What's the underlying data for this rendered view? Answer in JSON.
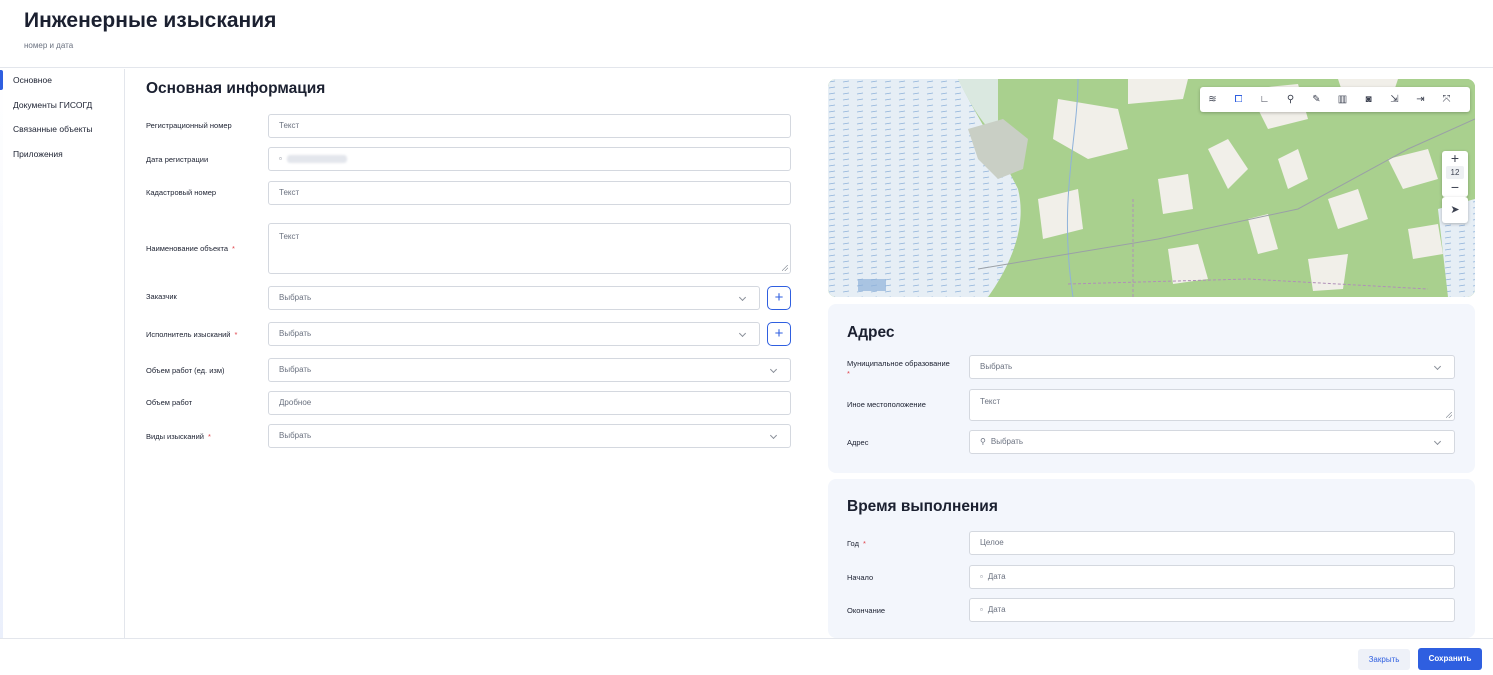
{
  "header": {
    "title": "Инженерные изыскания",
    "subtitle": "номер и дата"
  },
  "sidebar": {
    "items": [
      {
        "label": "Основное",
        "active": true
      },
      {
        "label": "Документы ГИСОГД",
        "active": false
      },
      {
        "label": "Связанные объекты",
        "active": false
      },
      {
        "label": "Приложения",
        "active": false
      }
    ]
  },
  "main_info": {
    "title": "Основная информация",
    "fields": {
      "reg_number": {
        "label": "Регистрационный номер",
        "placeholder": "Текст"
      },
      "reg_date": {
        "label": "Дата регистрации"
      },
      "cadastral": {
        "label": "Кадастровый номер",
        "placeholder": "Текст"
      },
      "object_name": {
        "label": "Наименование объекта",
        "placeholder": "Текст",
        "required": true
      },
      "customer": {
        "label": "Заказчик",
        "placeholder": "Выбрать"
      },
      "executor": {
        "label": "Исполнитель изысканий",
        "placeholder": "Выбрать",
        "required": true
      },
      "volume_unit": {
        "label": "Объем работ (ед. изм)",
        "placeholder": "Выбрать"
      },
      "volume": {
        "label": "Объем работ",
        "placeholder": "Дробное"
      },
      "survey_types": {
        "label": "Виды изысканий",
        "placeholder": "Выбрать",
        "required": true
      }
    },
    "add_symbol": "+",
    "required_mark": "*"
  },
  "map": {
    "zoom_level": "12",
    "zoom_in": "+",
    "zoom_out": "−",
    "tools": [
      "layers-icon",
      "polygon-select-icon",
      "ruler-icon",
      "search-icon",
      "pencil-icon",
      "trash-icon",
      "camera-icon",
      "import-icon",
      "export-icon",
      "fullscreen-icon"
    ],
    "colors": {
      "land": "#a9d08e",
      "water": "#b9cfe8",
      "clearing": "#f1efe9",
      "road": "#9aa0a6"
    }
  },
  "address": {
    "title": "Адрес",
    "fields": {
      "municipal": {
        "label": "Муниципальное образование",
        "placeholder": "Выбрать",
        "required": true
      },
      "other_location": {
        "label": "Иное местоположение",
        "placeholder": "Текст"
      },
      "address": {
        "label": "Адрес",
        "placeholder": "Выбрать"
      }
    }
  },
  "execution_time": {
    "title": "Время выполнения",
    "fields": {
      "year": {
        "label": "Год",
        "placeholder": "Целое",
        "required": true
      },
      "start": {
        "label": "Начало",
        "placeholder": "Дата"
      },
      "end": {
        "label": "Окончание",
        "placeholder": "Дата"
      }
    }
  },
  "footer": {
    "close_label": "Закрыть",
    "save_label": "Сохранить"
  },
  "colors": {
    "accent": "#2f5fe0",
    "required": "#e0424a",
    "panel_bg": "#f3f6fc"
  }
}
